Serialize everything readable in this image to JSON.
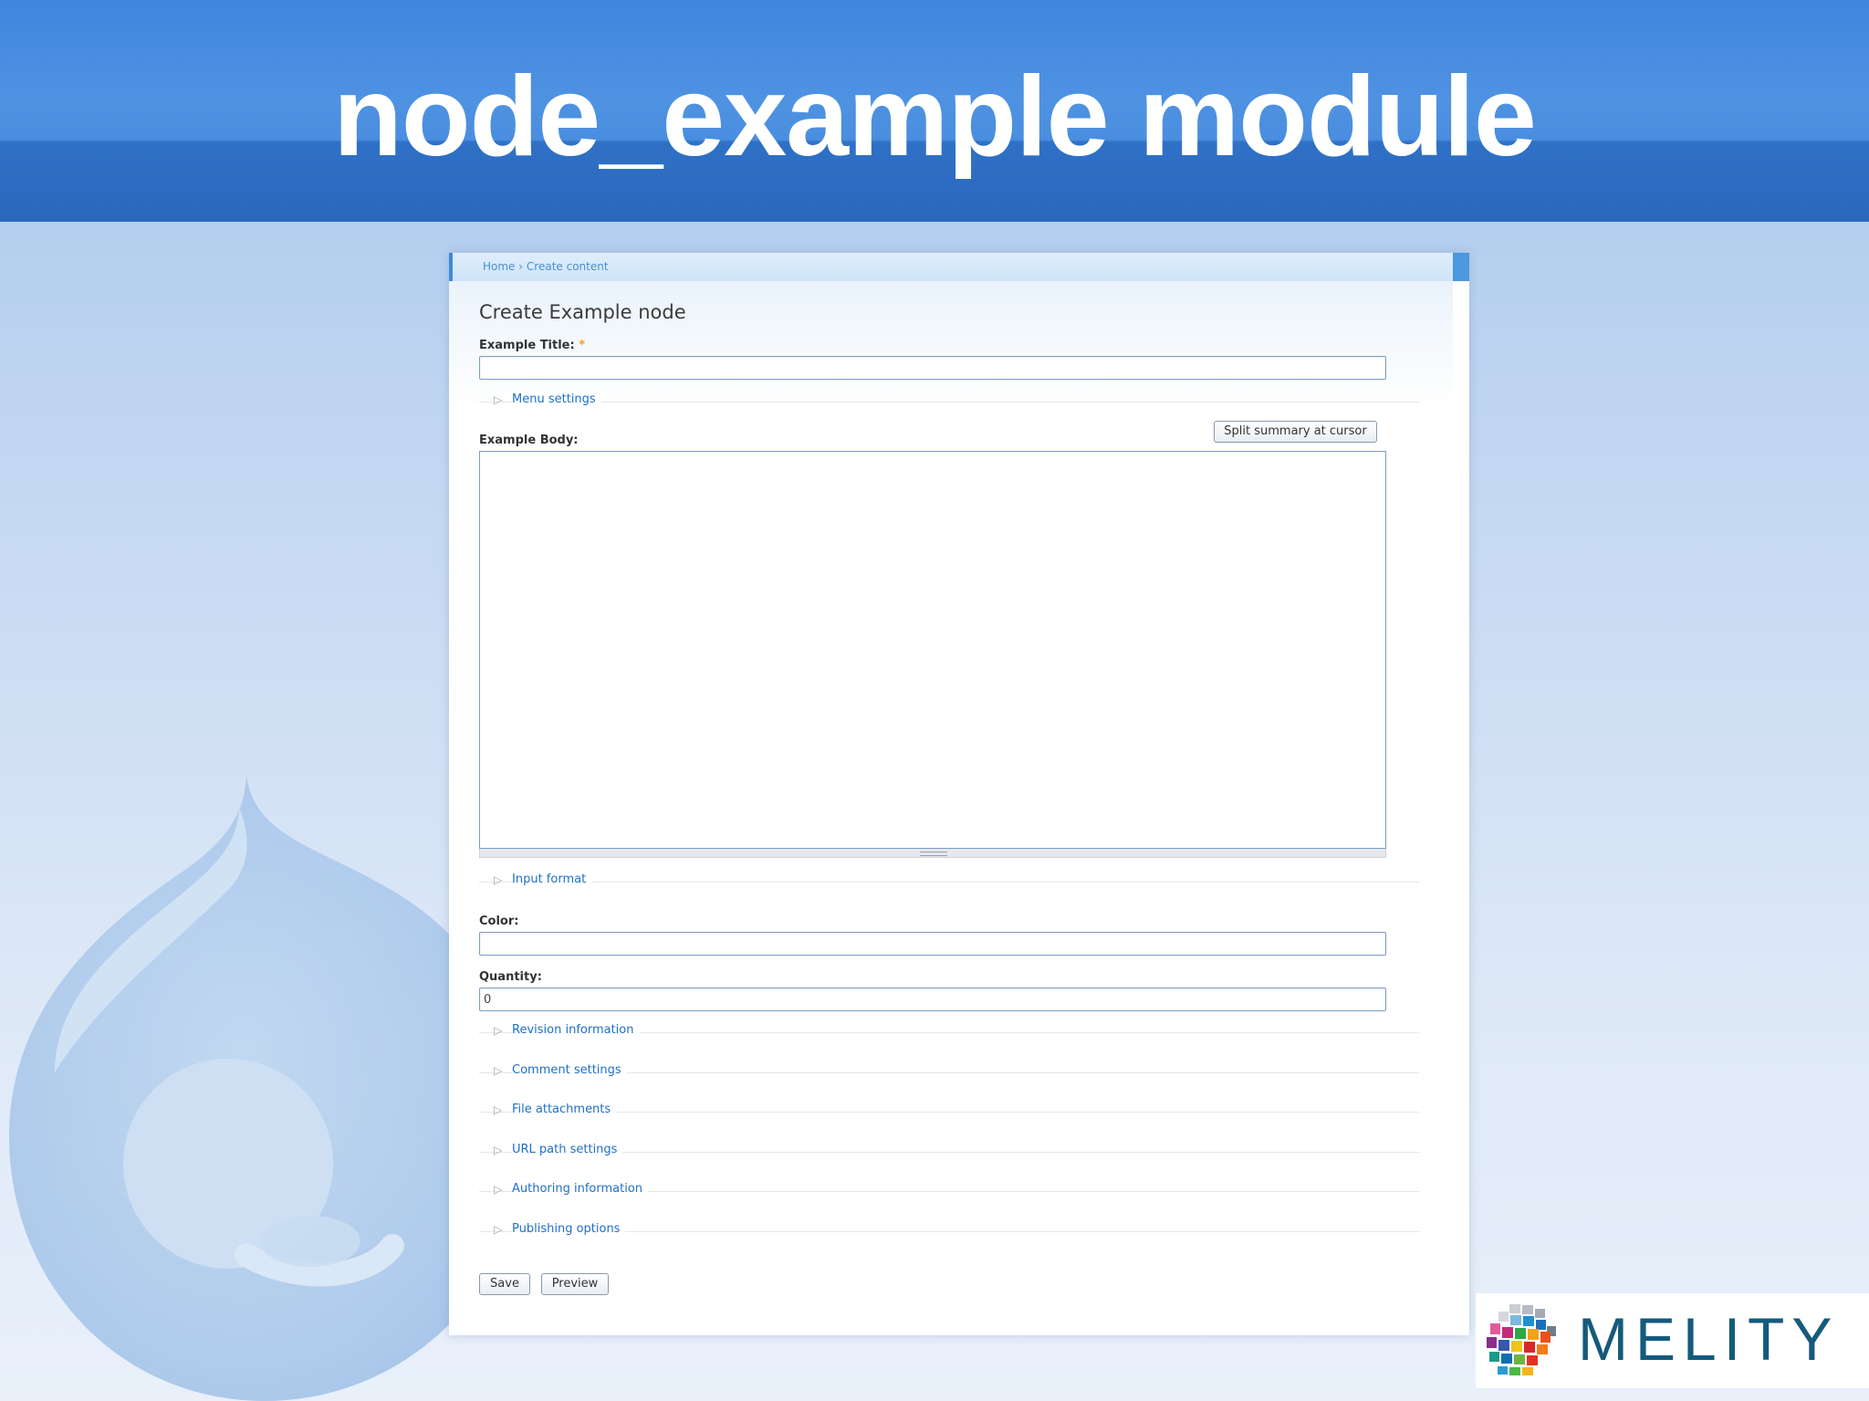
{
  "slide": {
    "title": "node_example module"
  },
  "breadcrumb": {
    "home": "Home",
    "separator": "›",
    "current": "Create content"
  },
  "form": {
    "page_title": "Create Example node",
    "title_label": "Example Title:",
    "required_marker": "*",
    "title_value": "",
    "body_label": "Example Body:",
    "split_button": "Split summary at cursor",
    "body_value": "",
    "color_label": "Color:",
    "color_value": "",
    "quantity_label": "Quantity:",
    "quantity_value": "0",
    "fieldsets": {
      "menu_settings": "Menu settings",
      "input_format": "Input format",
      "revision_information": "Revision information",
      "comment_settings": "Comment settings",
      "file_attachments": "File attachments",
      "url_path_settings": "URL path settings",
      "authoring_information": "Authoring information",
      "publishing_options": "Publishing options"
    },
    "save_button": "Save",
    "preview_button": "Preview"
  },
  "logo": {
    "text": "MELITY"
  },
  "colors": {
    "banner": "#3f86df",
    "link": "#1f6fc6",
    "logo_text": "#155a7c"
  }
}
